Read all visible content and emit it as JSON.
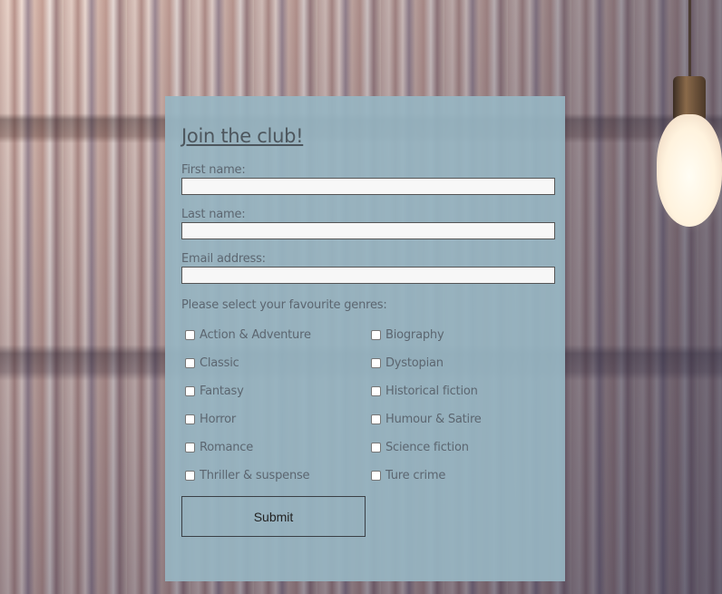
{
  "form": {
    "title": "Join the club!",
    "fields": [
      {
        "label": "First name:",
        "value": ""
      },
      {
        "label": "Last name:",
        "value": ""
      },
      {
        "label": "Email address:",
        "value": ""
      }
    ],
    "genres_label": "Please select your favourite genres:",
    "genres": [
      {
        "label": "Action & Adventure",
        "checked": false
      },
      {
        "label": "Biography",
        "checked": false
      },
      {
        "label": "Classic",
        "checked": false
      },
      {
        "label": "Dystopian",
        "checked": false
      },
      {
        "label": "Fantasy",
        "checked": false
      },
      {
        "label": "Historical fiction",
        "checked": false
      },
      {
        "label": "Horror",
        "checked": false
      },
      {
        "label": "Humour & Satire",
        "checked": false
      },
      {
        "label": "Romance",
        "checked": false
      },
      {
        "label": "Science fiction",
        "checked": false
      },
      {
        "label": "Thriller & suspense",
        "checked": false
      },
      {
        "label": "Ture crime",
        "checked": false
      }
    ],
    "submit_label": "Submit"
  },
  "colors": {
    "panel": "#97B5C2",
    "text": "#5C6670",
    "title": "#4D565D"
  },
  "background": {
    "icon": "library-bookshelf-background"
  }
}
